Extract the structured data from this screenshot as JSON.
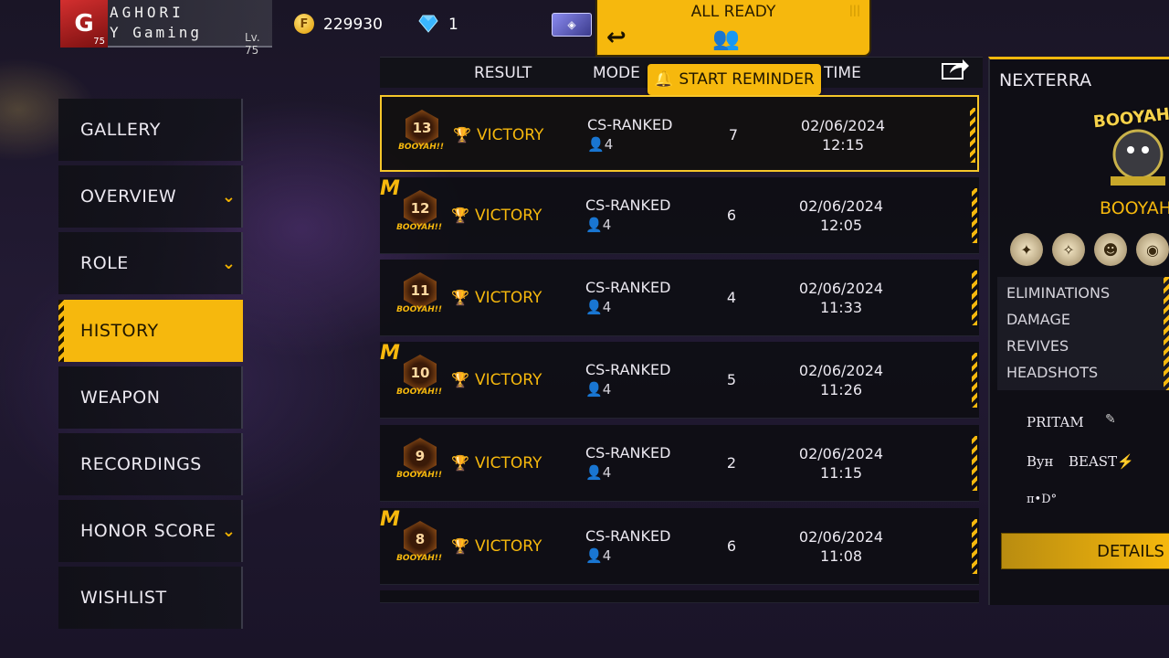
{
  "topbar": {
    "rank_badge": "G",
    "rank_badge_level": "75",
    "player_name_line1": "AGHORI",
    "player_name_line2": "Y Gaming",
    "player_level": "Lv. 75",
    "gold_icon": "F",
    "gold": "229930",
    "diamonds": "1",
    "all_ready": "ALL READY",
    "start_reminder": "START REMINDER"
  },
  "sidebar": {
    "items": [
      {
        "label": "GALLERY",
        "has_chevron": false,
        "active": false
      },
      {
        "label": "OVERVIEW",
        "has_chevron": true,
        "active": false
      },
      {
        "label": "ROLE",
        "has_chevron": true,
        "active": false
      },
      {
        "label": "HISTORY",
        "has_chevron": false,
        "active": true
      },
      {
        "label": "WEAPON",
        "has_chevron": false,
        "active": false
      },
      {
        "label": "RECORDINGS",
        "has_chevron": false,
        "active": false
      },
      {
        "label": "HONOR SCORE",
        "has_chevron": true,
        "active": false
      },
      {
        "label": "WISHLIST",
        "has_chevron": false,
        "active": false
      }
    ]
  },
  "table": {
    "headers": {
      "result": "RESULT",
      "mode": "MODE",
      "time": "TIME"
    },
    "rows": [
      {
        "rank": "13",
        "mvp": false,
        "result": "VICTORY",
        "mode": "CS-RANKED",
        "players": "4",
        "kills": "7",
        "date": "02/06/2024",
        "time": "12:15",
        "selected": true
      },
      {
        "rank": "12",
        "mvp": true,
        "result": "VICTORY",
        "mode": "CS-RANKED",
        "players": "4",
        "kills": "6",
        "date": "02/06/2024",
        "time": "12:05",
        "selected": false
      },
      {
        "rank": "11",
        "mvp": false,
        "result": "VICTORY",
        "mode": "CS-RANKED",
        "players": "4",
        "kills": "4",
        "date": "02/06/2024",
        "time": "11:33",
        "selected": false
      },
      {
        "rank": "10",
        "mvp": true,
        "result": "VICTORY",
        "mode": "CS-RANKED",
        "players": "4",
        "kills": "5",
        "date": "02/06/2024",
        "time": "11:26",
        "selected": false
      },
      {
        "rank": "9",
        "mvp": false,
        "result": "VICTORY",
        "mode": "CS-RANKED",
        "players": "4",
        "kills": "2",
        "date": "02/06/2024",
        "time": "11:15",
        "selected": false
      },
      {
        "rank": "8",
        "mvp": true,
        "result": "VICTORY",
        "mode": "CS-RANKED",
        "players": "4",
        "kills": "6",
        "date": "02/06/2024",
        "time": "11:08",
        "selected": false
      }
    ],
    "badge_caption": "BOOYAH!!"
  },
  "detail": {
    "map": "NEXTERRA",
    "booyah_art": "BOOYAH",
    "result_label": "BOOYAH",
    "stats": [
      "ELIMINATIONS",
      "DAMAGE",
      "REVIVES",
      "HEADSHOTS"
    ],
    "team": [
      "PRITAM",
      "Byн",
      "BEAST⚡",
      "π•D°"
    ],
    "details_button": "DETAILS"
  },
  "colors": {
    "accent": "#f6b80d",
    "panel": "#0e0e14",
    "text": "#ece9f1"
  }
}
